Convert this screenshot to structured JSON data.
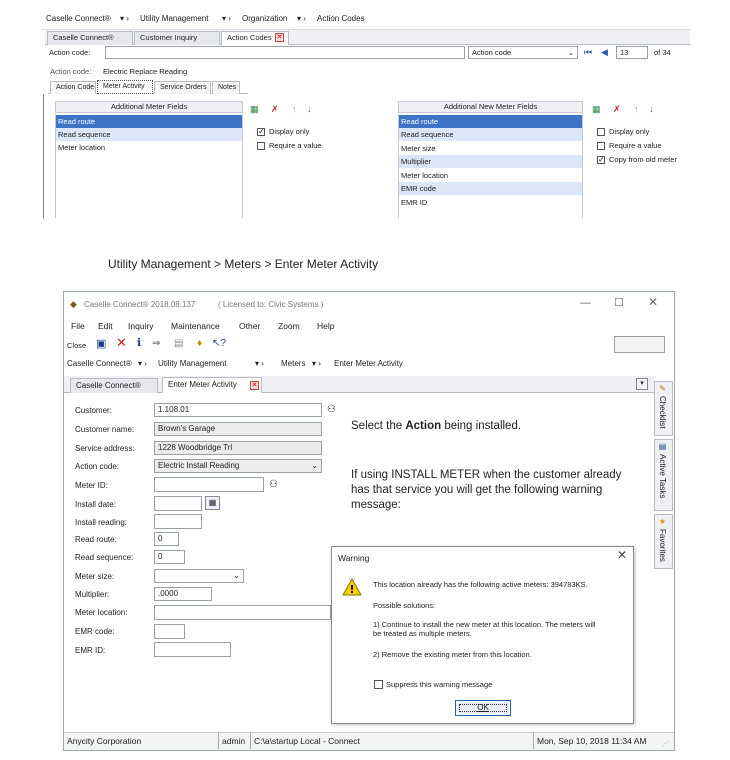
{
  "top_panel": {
    "breadcrumb": [
      "Caselle Connect®",
      "Utility Management",
      "Organization",
      "Action Codes"
    ],
    "tabs": [
      "Caselle Connect®",
      "Customer Inquiry",
      "Action Codes"
    ],
    "action_code_label": "Action code:",
    "action_code_select": "Action code",
    "record_index": "13",
    "record_total": "of 34",
    "action_code_desc_label": "Action code:",
    "action_code_desc_value": "Electric Replace Reading",
    "sub_tabs": [
      "Action Code",
      "Meter Activity",
      "Service Orders",
      "Notes"
    ],
    "left_list": {
      "header": "Additional Meter Fields",
      "items": [
        "Read route",
        "Read sequence",
        "Meter location"
      ]
    },
    "left_options": [
      "Display only",
      "Require a value"
    ],
    "right_list": {
      "header": "Additional New Meter Fields",
      "items": [
        "Read route",
        "Read sequence",
        "Meter size",
        "Multiplier",
        "Meter location",
        "EMR code",
        "EMR ID"
      ]
    },
    "right_options": [
      "Display only",
      "Require a value",
      "Copy from old meter"
    ]
  },
  "section_heading": "Utility Management > Meters > Enter Meter Activity",
  "window": {
    "title": "Caselle Connect® 2018.08.137",
    "license": "( Licensed to: Civic Systems )",
    "menu": [
      "File",
      "Edit",
      "Inquiry",
      "Maintenance",
      "Other",
      "Zoom",
      "Help"
    ],
    "close_label": "Close",
    "breadcrumb": [
      "Caselle Connect®",
      "Utility Management",
      "Meters",
      "Enter Meter Activity"
    ],
    "tabs": [
      "Caselle Connect®",
      "Enter Meter Activity"
    ],
    "side_tabs": [
      "Checklist",
      "Active Tasks",
      "Favorites"
    ],
    "form": {
      "customer_label": "Customer:",
      "customer_value": "1.108.01",
      "customer_name_label": "Customer name:",
      "customer_name_value": "Brown's Garage",
      "service_address_label": "Service address:",
      "service_address_value": "1228 Woodbridge Trl",
      "action_code_label": "Action code:",
      "action_code_value": "Electric Install Reading",
      "meter_id_label": "Meter ID:",
      "install_date_label": "Install date:",
      "install_reading_label": "Install reading:",
      "read_route_label": "Read route:",
      "read_route_value": "0",
      "read_sequence_label": "Read sequence:",
      "read_sequence_value": "0",
      "meter_size_label": "Meter size:",
      "multiplier_label": "Multiplier:",
      "multiplier_value": ".0000",
      "meter_location_label": "Meter location:",
      "emr_code_label": "EMR code:",
      "emr_id_label": "EMR ID:"
    },
    "instructions": {
      "line1_pre": "Select the ",
      "line1_bold": "Action",
      "line1_post": " being installed.",
      "para2_line1": "If using INSTALL METER when the customer already",
      "para2_line2": "has that service you will get the following warning",
      "para2_line3": "message:"
    },
    "dialog": {
      "title": "Warning",
      "message": "This location already has the following active meters: 394783KS.",
      "solutions_heading": "Possible solutions:",
      "solution1_line1": "1) Continue to install the new meter at this location.  The meters will",
      "solution1_line2": "be treated as multiple meters.",
      "solution2": "2) Remove the existing meter from this location.",
      "suppress_label": "Suppress this warning message",
      "ok_label": "OK"
    },
    "status_bar": {
      "org": "Anycity Corporation",
      "user": "admin",
      "path": "C:\\a\\startup Local - Connect",
      "datetime": "Mon, Sep 10, 2018 11:34 AM"
    }
  }
}
